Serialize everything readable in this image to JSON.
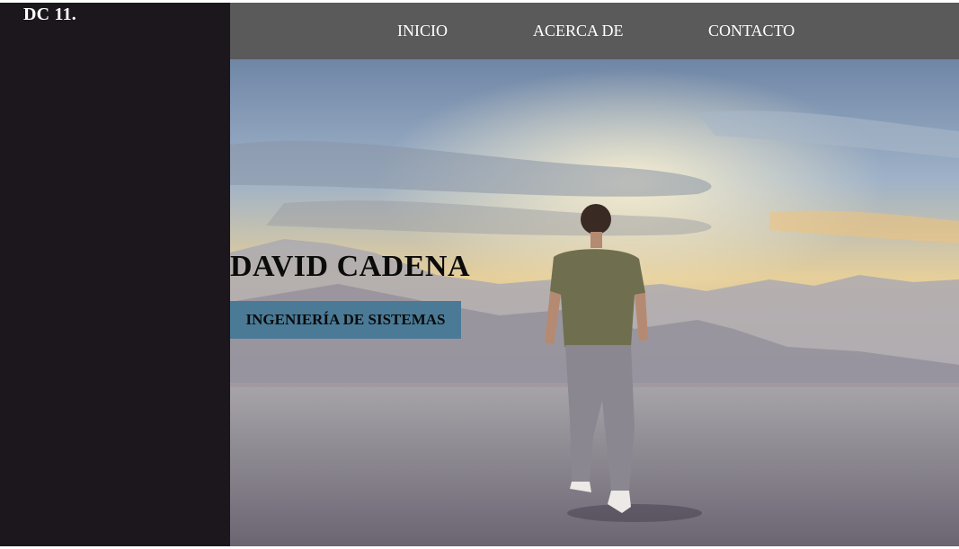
{
  "brand": {
    "logo_text": "DC 11."
  },
  "nav": {
    "items": [
      {
        "label": "INICIO"
      },
      {
        "label": "ACERCA DE"
      },
      {
        "label": "CONTACTO"
      }
    ]
  },
  "hero": {
    "name": "DAVID CADENA",
    "tagline": "INGENIERÍA DE SISTEMAS"
  },
  "colors": {
    "sidebar_bg": "#1c171c",
    "navbar_bg": "#5a5a5a",
    "tagline_bg": "#4a7a96",
    "text_light": "#ffffff",
    "text_dark": "#0b0b0b"
  }
}
